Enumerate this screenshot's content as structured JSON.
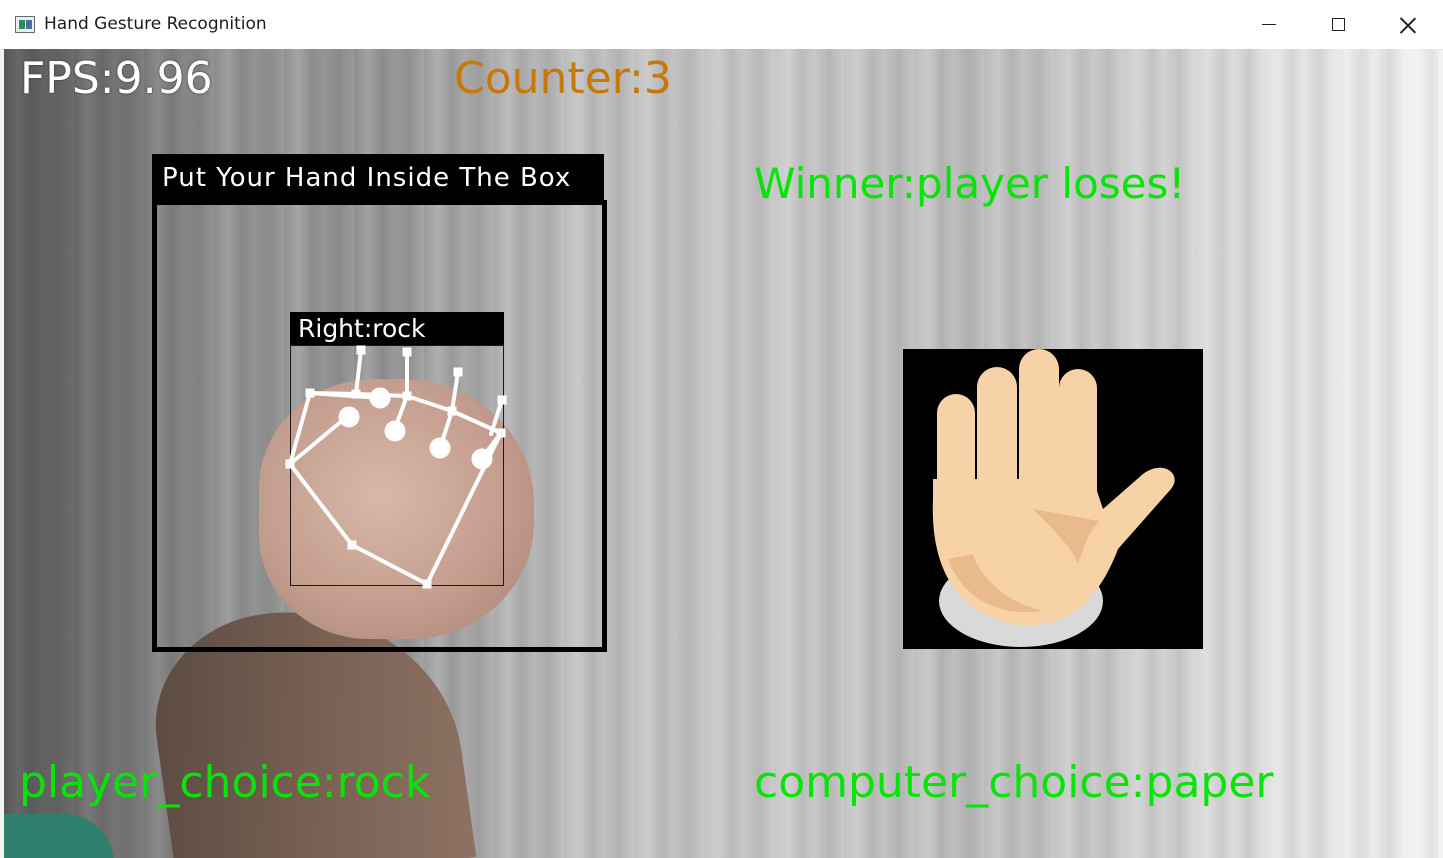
{
  "window": {
    "title": "Hand Gesture Recognition",
    "controls": [
      "minimize",
      "maximize",
      "close"
    ]
  },
  "overlay": {
    "fps_text": "FPS:9.96",
    "counter_text": "Counter:3",
    "winner_text": "Winner:player  loses!",
    "box_prompt": "Put Your Hand Inside The Box",
    "hand_label": "Right:rock",
    "player_choice_text": "player_choice:rock",
    "computer_choice_text": "computer_choice:paper"
  },
  "computer_choice_icon": "raised-hand-emoji",
  "colors": {
    "fps": "#ffffff",
    "counter": "#c8780a",
    "status_green": "#08e408",
    "label_bg": "#000000",
    "skin_light": "#f6d2a6",
    "skin_shadow": "#e3b286"
  }
}
